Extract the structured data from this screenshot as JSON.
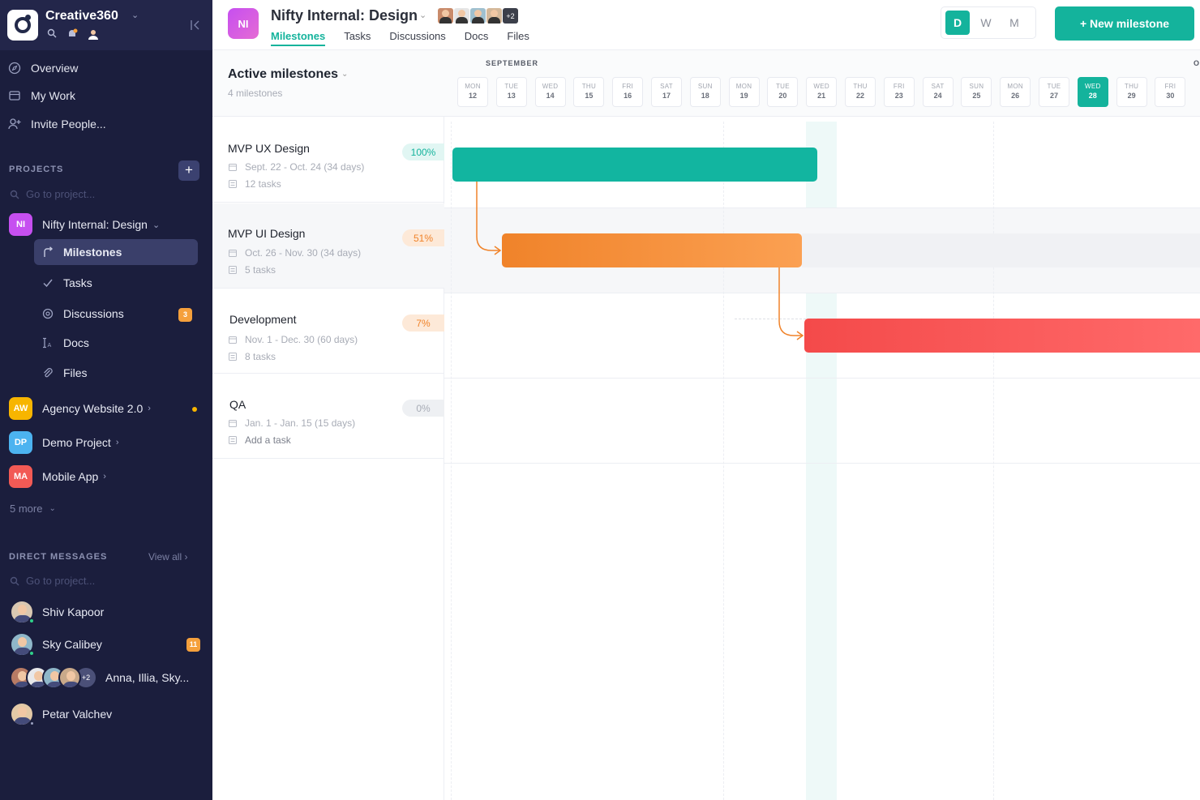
{
  "workspace": {
    "name": "Creative360"
  },
  "sidebar": {
    "nav": [
      {
        "label": "Overview",
        "icon": "overview-icon"
      },
      {
        "label": "My Work",
        "icon": "my-work-icon"
      },
      {
        "label": "Invite People...",
        "icon": "invite-people-icon"
      }
    ],
    "projects_label": "PROJECTS",
    "projects_search_placeholder": "Go to project...",
    "current_project": {
      "badge": "NI",
      "name": "Nifty Internal: Design",
      "color": "#c64ff0"
    },
    "subnav": [
      {
        "label": "Milestones",
        "icon": "milestones-icon",
        "active": true
      },
      {
        "label": "Tasks",
        "icon": "check-icon"
      },
      {
        "label": "Discussions",
        "icon": "discussions-icon",
        "badge": "3"
      },
      {
        "label": "Docs",
        "icon": "docs-icon"
      },
      {
        "label": "Files",
        "icon": "paperclip-icon"
      }
    ],
    "other_projects": [
      {
        "badge": "AW",
        "name": "Agency Website 2.0",
        "color": "#f7b500"
      },
      {
        "badge": "DP",
        "name": "Demo Project",
        "color": "#4cb3f0"
      },
      {
        "badge": "MA",
        "name": "Mobile App",
        "color": "#f25a55"
      }
    ],
    "more_label": "5 more",
    "dm_label": "DIRECT MESSAGES",
    "dm_view_all": "View all",
    "dm_search_placeholder": "Go to project...",
    "dms": [
      {
        "name": "Shiv Kapoor",
        "online": true
      },
      {
        "name": "Sky Calibey",
        "online": true,
        "badge": "11"
      },
      {
        "name": "Anna, Illia, Sky...",
        "group": true,
        "plus": "+2"
      },
      {
        "name": "Petar Valchev",
        "online": false
      }
    ]
  },
  "header": {
    "badge": "NI",
    "title": "Nifty Internal: Design",
    "members_plus": "+2",
    "tabs": [
      "Milestones",
      "Tasks",
      "Discussions",
      "Docs",
      "Files"
    ],
    "active_tab": "Milestones",
    "zoom_options": [
      "D",
      "W",
      "M"
    ],
    "zoom_selected": "D",
    "new_milestone_label": "+ New milestone",
    "accent": "#14b39c"
  },
  "milestones_panel": {
    "title": "Active milestones",
    "count": "4 milestones",
    "items": [
      {
        "name": "MVP UX Design",
        "dates": "Sept. 22 - Oct. 24 (34 days)",
        "tasks": "12 tasks",
        "progress": "100%",
        "progress_value": 100,
        "color": "#12b5a0"
      },
      {
        "name": "MVP UI Design",
        "dates": "Oct. 26 - Nov. 30 (34 days)",
        "tasks": "5 tasks",
        "progress": "51%",
        "progress_value": 51,
        "color": "#f0832a"
      },
      {
        "name": "Development",
        "dates": "Nov. 1 - Dec. 30 (60 days)",
        "tasks": "8 tasks",
        "progress": "7%",
        "progress_value": 7,
        "color": "#f44a4a"
      },
      {
        "name": "QA",
        "dates": "Jan. 1 - Jan. 15 (15 days)",
        "tasks": "Add a task",
        "progress": "0%",
        "progress_value": 0,
        "color": "#b0b4bd"
      }
    ]
  },
  "timeline": {
    "month": "SEPTEMBER",
    "next_month_initial": "O",
    "days": [
      {
        "dow": "MON",
        "date": "12"
      },
      {
        "dow": "TUE",
        "date": "13"
      },
      {
        "dow": "WED",
        "date": "14"
      },
      {
        "dow": "THU",
        "date": "15"
      },
      {
        "dow": "FRI",
        "date": "16"
      },
      {
        "dow": "SAT",
        "date": "17"
      },
      {
        "dow": "SUN",
        "date": "18"
      },
      {
        "dow": "MON",
        "date": "19"
      },
      {
        "dow": "TUE",
        "date": "20"
      },
      {
        "dow": "WED",
        "date": "21"
      },
      {
        "dow": "THU",
        "date": "22"
      },
      {
        "dow": "FRI",
        "date": "23"
      },
      {
        "dow": "SAT",
        "date": "24"
      },
      {
        "dow": "SUN",
        "date": "25"
      },
      {
        "dow": "MON",
        "date": "26"
      },
      {
        "dow": "TUE",
        "date": "27"
      },
      {
        "dow": "WED",
        "date": "28",
        "today": true
      },
      {
        "dow": "THU",
        "date": "29"
      },
      {
        "dow": "FRI",
        "date": "30"
      }
    ]
  }
}
